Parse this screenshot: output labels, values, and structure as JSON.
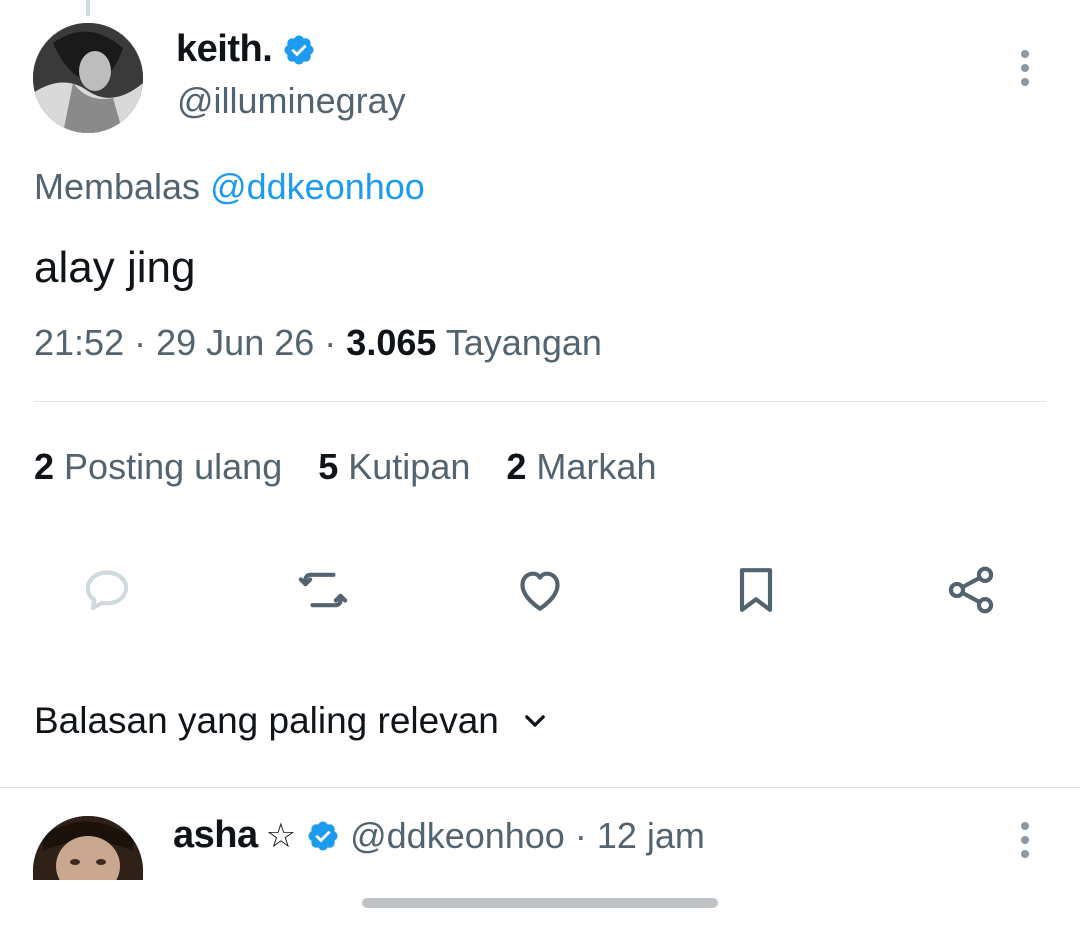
{
  "tweet": {
    "author_name": "keith.",
    "author_handle": "@illuminegray",
    "verified_icon": "verified-badge-icon",
    "replying_prefix": "Membalas",
    "replying_to": "@ddkeonhoo",
    "text": "alay jing",
    "time": "21:52",
    "date": "29 Jun 26",
    "views_count": "3.065",
    "views_label": "Tayangan",
    "separator": "·"
  },
  "stats": {
    "reposts_count": "2",
    "reposts_label": "Posting ulang",
    "quotes_count": "5",
    "quotes_label": "Kutipan",
    "bookmarks_count": "2",
    "bookmarks_label": "Markah"
  },
  "actions": [
    "reply-icon",
    "repost-icon",
    "like-icon",
    "bookmark-icon",
    "share-icon"
  ],
  "sort": {
    "label": "Balasan yang paling relevan"
  },
  "reply": {
    "author_name": "asha",
    "star": "☆",
    "author_handle": "@ddkeonhoo",
    "separator": "·",
    "time": "12 jam"
  },
  "colors": {
    "accent": "#1d9bf0",
    "text_primary": "#0f1419",
    "text_secondary": "#536471",
    "icon_gray": "#536471"
  }
}
